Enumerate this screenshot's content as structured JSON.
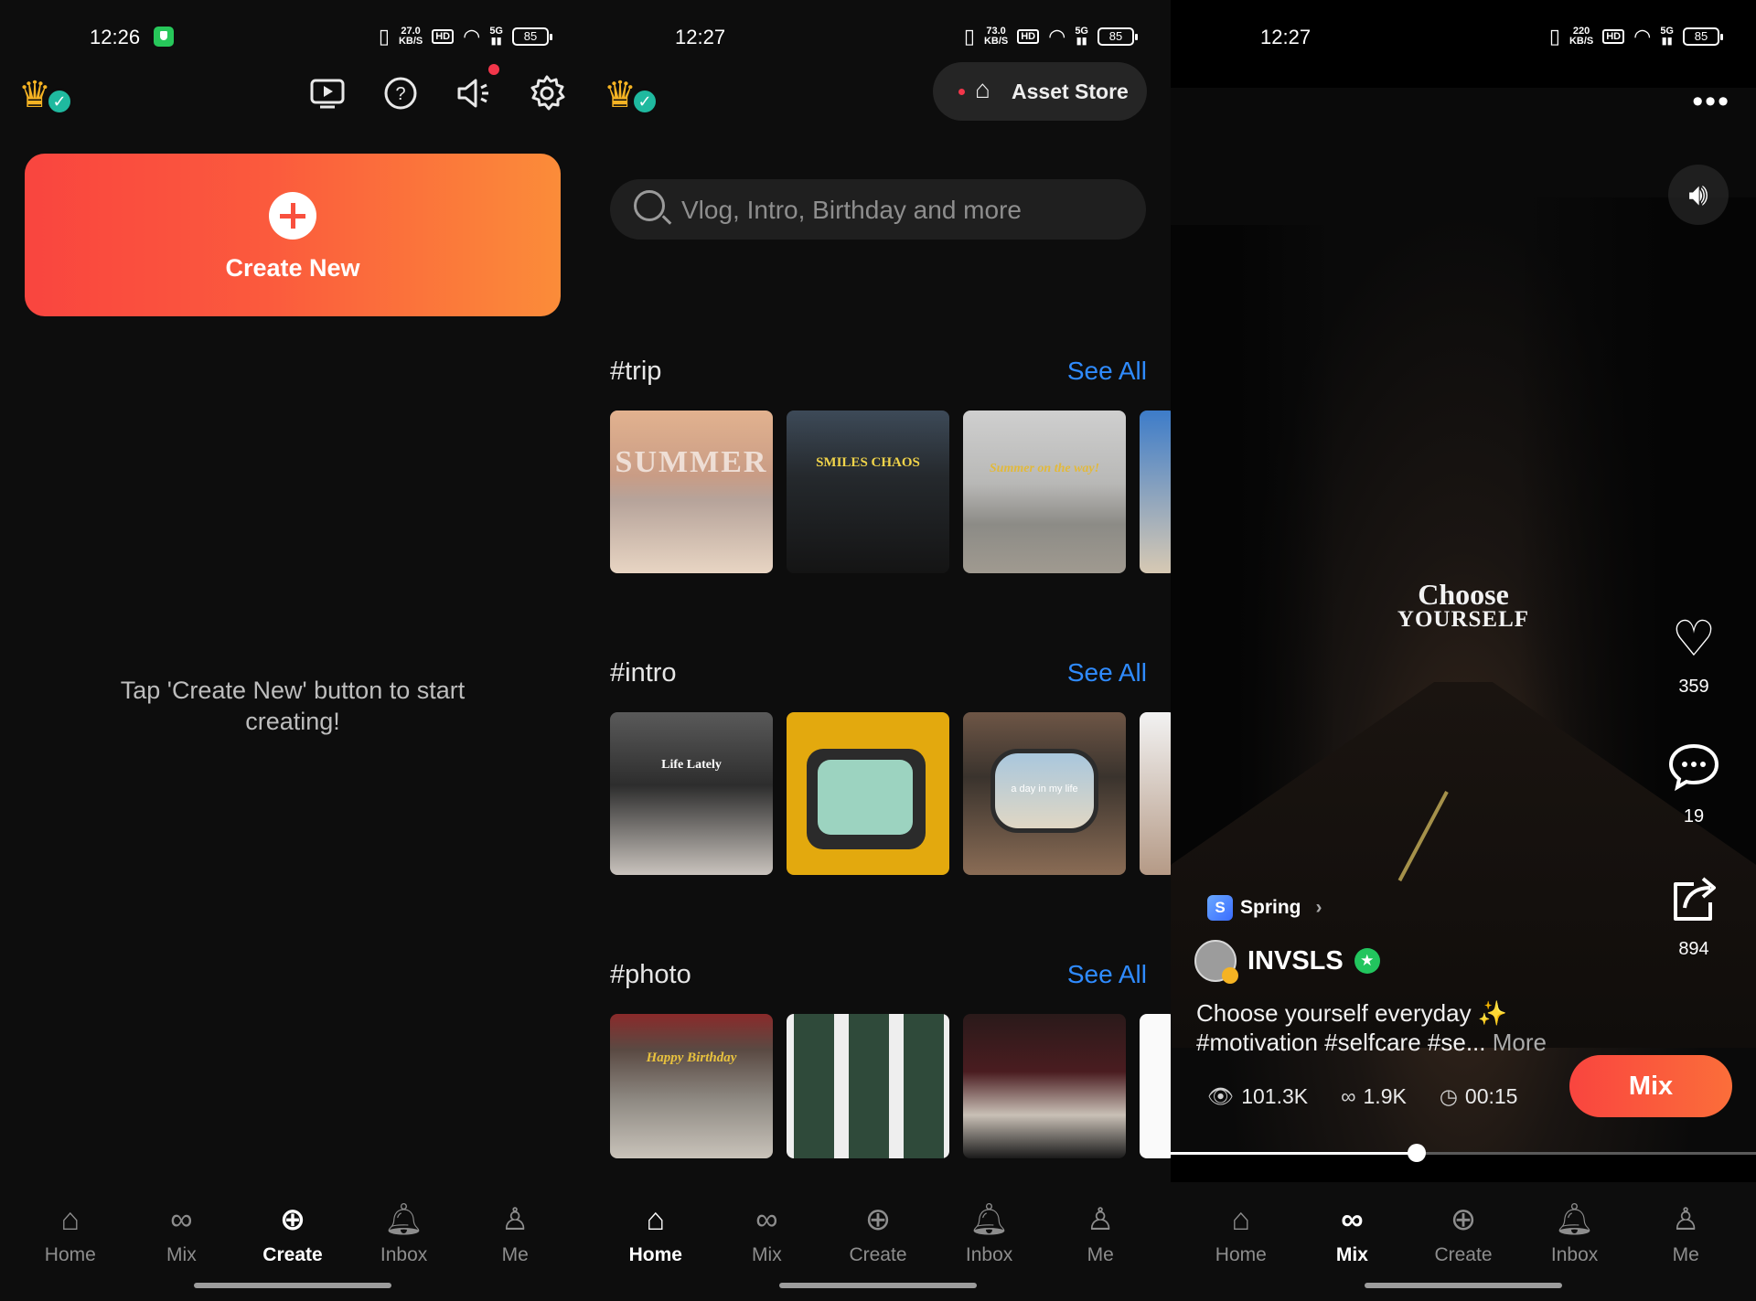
{
  "panel1": {
    "status": {
      "time": "12:26",
      "net_speed": "27.0",
      "net_unit": "KB/S",
      "hd": "HD",
      "signal": "5G",
      "battery": "85"
    },
    "top_icons": [
      "video-play-icon",
      "help-icon",
      "megaphone-icon",
      "gear-icon"
    ],
    "create_new_label": "Create New",
    "hint": "Tap 'Create New' button to start creating!",
    "nav": {
      "home": "Home",
      "mix": "Mix",
      "create": "Create",
      "inbox": "Inbox",
      "me": "Me",
      "active": "Create"
    }
  },
  "panel2": {
    "status": {
      "time": "12:27",
      "net_speed": "73.0",
      "net_unit": "KB/S",
      "hd": "HD",
      "signal": "5G",
      "battery": "85"
    },
    "asset_store_label": "Asset Store",
    "search_placeholder": "Vlog, Intro, Birthday and more",
    "sections": [
      {
        "tag": "#trip",
        "see_all": "See All",
        "thumbs": [
          "SUMMER",
          "SMILES CHAOS",
          "Summer on the way!"
        ]
      },
      {
        "tag": "#intro",
        "see_all": "See All",
        "thumbs": [
          "Life Lately",
          "",
          "a day in my life"
        ]
      },
      {
        "tag": "#photo",
        "see_all": "See All",
        "thumbs": [
          "Happy Birthday",
          "",
          ""
        ]
      }
    ],
    "nav": {
      "home": "Home",
      "mix": "Mix",
      "create": "Create",
      "inbox": "Inbox",
      "me": "Me",
      "active": "Home"
    }
  },
  "panel3": {
    "status": {
      "time": "12:27",
      "net_speed": "220",
      "net_unit": "KB/S",
      "hd": "HD",
      "signal": "5G",
      "battery": "85"
    },
    "overlay_line1": "Choose",
    "overlay_line2": "YOURSELF",
    "likes": "359",
    "comments": "19",
    "shares": "894",
    "template_chip": "Spring",
    "author": "INVSLS",
    "caption_line1": "Choose yourself everyday ✨",
    "caption_line2": "#motivation #selfcare #se...",
    "caption_more": "More",
    "views": "101.3K",
    "mixes": "1.9K",
    "duration": "00:15",
    "mix_button": "Mix",
    "progress": 0.42,
    "nav": {
      "home": "Home",
      "mix": "Mix",
      "create": "Create",
      "inbox": "Inbox",
      "me": "Me",
      "active": "Mix"
    }
  }
}
